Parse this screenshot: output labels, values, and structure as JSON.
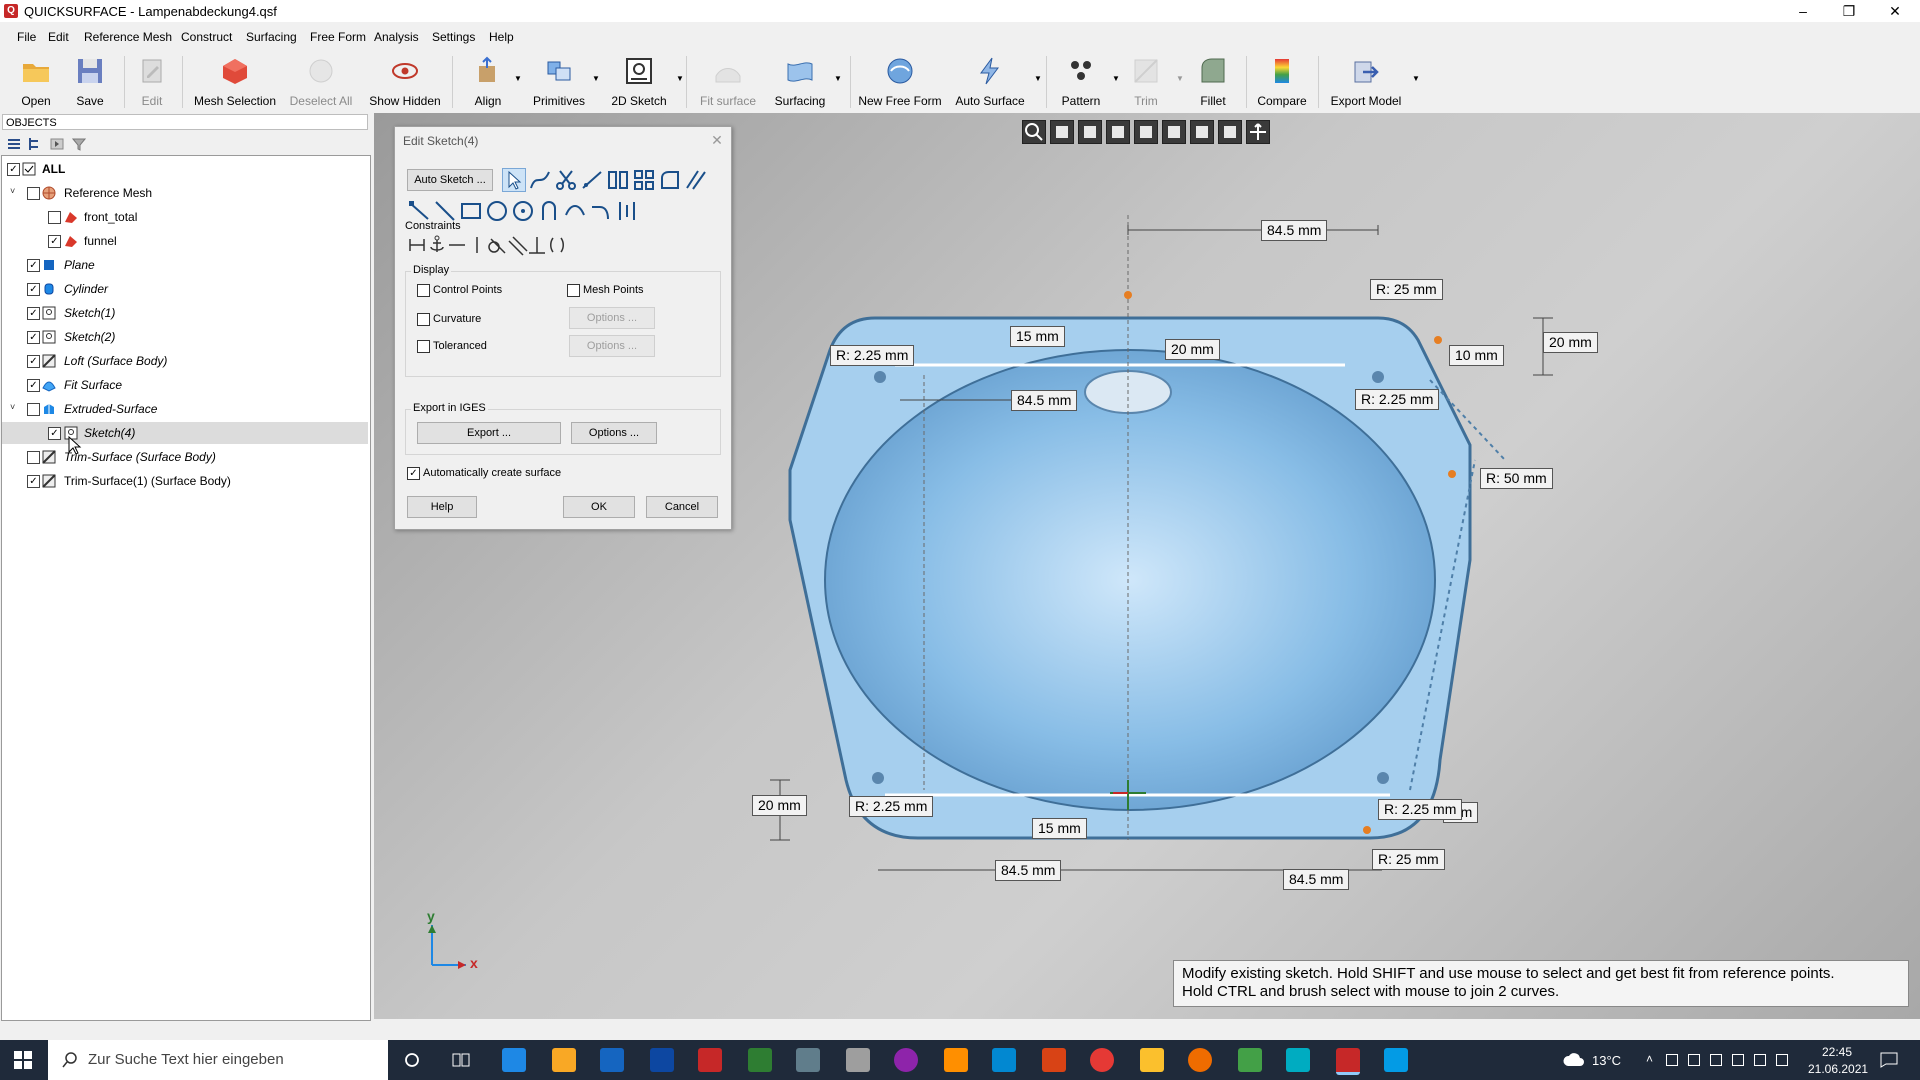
{
  "window": {
    "title": "QUICKSURFACE - Lampenabdeckung4.qsf",
    "minimize": "–",
    "restore": "❐",
    "close": "✕"
  },
  "menu": [
    "File",
    "Edit",
    "Reference Mesh",
    "Construct",
    "Surfacing",
    "Free Form",
    "Analysis",
    "Settings",
    "Help"
  ],
  "toolbar": {
    "open": "Open",
    "save": "Save",
    "edit": "Edit",
    "mesh_selection": "Mesh Selection",
    "deselect_all": "Deselect All",
    "show_hidden": "Show Hidden",
    "align": "Align",
    "primitives": "Primitives",
    "sketch2d": "2D Sketch",
    "fit_surface": "Fit surface",
    "surfacing": "Surfacing",
    "new_free_form": "New Free Form",
    "auto_surface": "Auto Surface",
    "pattern": "Pattern",
    "trim": "Trim",
    "fillet": "Fillet",
    "compare": "Compare",
    "export_model": "Export Model"
  },
  "objects": {
    "header": "OBJECTS",
    "items": [
      {
        "label": "ALL"
      },
      {
        "label": "Reference Mesh"
      },
      {
        "label": "front_total"
      },
      {
        "label": "funnel"
      },
      {
        "label": "Plane"
      },
      {
        "label": "Cylinder"
      },
      {
        "label": "Sketch(1)"
      },
      {
        "label": "Sketch(2)"
      },
      {
        "label": "Loft (Surface Body)"
      },
      {
        "label": "Fit Surface"
      },
      {
        "label": "Extruded-Surface"
      },
      {
        "label": "Sketch(4)"
      },
      {
        "label": "Trim-Surface (Surface Body)"
      },
      {
        "label": "Trim-Surface(1) (Surface Body)"
      }
    ]
  },
  "dialog": {
    "title": "Edit Sketch(4)",
    "close": "✕",
    "auto_sketch": "Auto Sketch ...",
    "constraints_label": "Constraints",
    "display_label": "Display",
    "control_points": "Control Points",
    "mesh_points": "Mesh Points",
    "curvature": "Curvature",
    "toleranced": "Toleranced",
    "options_disabled": "Options ...",
    "export_label": "Export in IGES",
    "export_button": "Export ...",
    "options_button": "Options ...",
    "auto_create": "Automatically create surface",
    "help": "Help",
    "ok": "OK",
    "cancel": "Cancel"
  },
  "dimensions": {
    "d_top": "84.5 mm",
    "r_top_right": "R: 25 mm",
    "d_20_right": "20 mm",
    "d_10": "10 mm",
    "r_225_tl": "R: 2.25 mm",
    "d_15_top": "15 mm",
    "d_20_top": "20 mm",
    "d_845_left": "84.5 mm",
    "r_225_tr": "R: 2.25 mm",
    "r_50": "R: 50 mm",
    "d_20_left": "20 mm",
    "r_225_bl": "R: 2.25 mm",
    "d_15_bottom": "15 mm",
    "r_225_br": "R: 2.25 mm",
    "d_mm_partial": "mm",
    "r_25_bottom": "R: 25 mm",
    "d_845_bottom_left": "84.5 mm",
    "d_845_bottom_right": "84.5 mm"
  },
  "axis": {
    "x": "x",
    "y": "y"
  },
  "hint": {
    "line1": "Modify existing sketch. Hold SHIFT and use mouse to select and get best fit from reference points.",
    "line2": "Hold CTRL and brush select with mouse to join 2 curves."
  },
  "taskbar": {
    "search_placeholder": "Zur Suche Text hier eingeben",
    "temperature": "13°C",
    "time": "22:45",
    "date": "21.06.2021"
  }
}
